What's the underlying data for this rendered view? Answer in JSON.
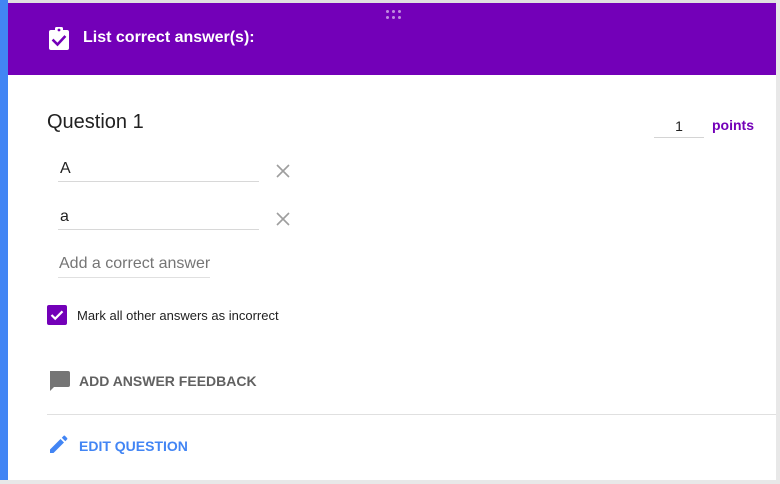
{
  "header": {
    "title": "List correct answer(s):",
    "icon": "assignment-check-icon",
    "background_color": "#7300b8"
  },
  "question": {
    "title": "Question 1",
    "points_value": "1",
    "points_label": "points"
  },
  "answers": [
    {
      "value": "A"
    },
    {
      "value": "a"
    }
  ],
  "add_answer_placeholder": "Add a correct answer",
  "mark_incorrect": {
    "checked": true,
    "label": "Mark all other answers as incorrect"
  },
  "feedback": {
    "label": "ADD ANSWER FEEDBACK",
    "icon": "comment-icon"
  },
  "edit": {
    "label": "EDIT QUESTION",
    "icon": "pencil-icon"
  },
  "colors": {
    "accent": "#7300b8",
    "link_blue": "#4285f4"
  }
}
